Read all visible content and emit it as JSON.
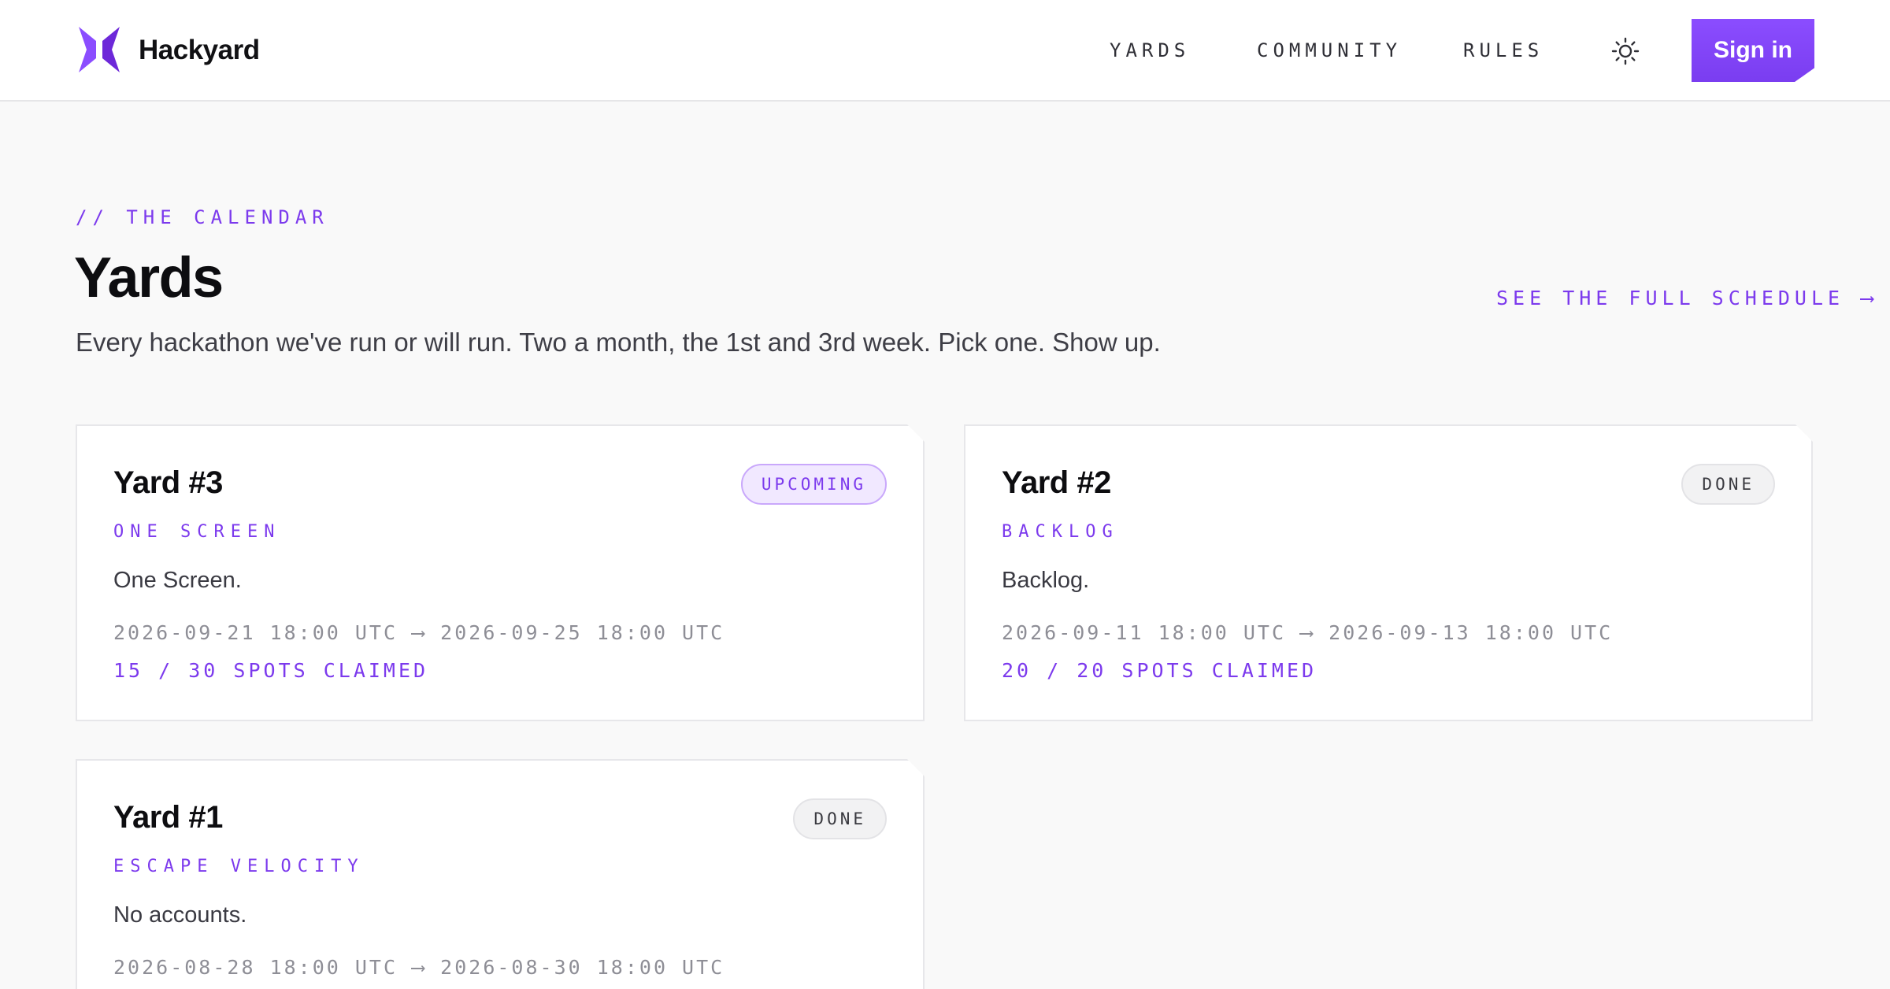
{
  "brand": {
    "name": "Hackyard",
    "accent": "#7c3aed"
  },
  "nav": {
    "items": [
      {
        "label": "YARDS"
      },
      {
        "label": "COMMUNITY"
      },
      {
        "label": "RULES"
      }
    ],
    "theme_icon": "sun-icon",
    "signin_label": "Sign in"
  },
  "hero": {
    "eyebrow": "// THE CALENDAR",
    "title": "Yards",
    "subtitle": "Every hackathon we've run or will run. Two a month, the 1st and 3rd week. Pick one. Show up.",
    "schedule_link": "SEE THE FULL SCHEDULE ⟶"
  },
  "yards": [
    {
      "title": "Yard #3",
      "status": "UPCOMING",
      "theme": "ONE SCREEN",
      "description": "One Screen.",
      "dates": "2026-09-21 18:00 UTC ⟶ 2026-09-25 18:00 UTC",
      "spots": "15 / 30 SPOTS CLAIMED"
    },
    {
      "title": "Yard #2",
      "status": "DONE",
      "theme": "BACKLOG",
      "description": "Backlog.",
      "dates": "2026-09-11 18:00 UTC ⟶ 2026-09-13 18:00 UTC",
      "spots": "20 / 20 SPOTS CLAIMED"
    },
    {
      "title": "Yard #1",
      "status": "DONE",
      "theme": "ESCAPE VELOCITY",
      "description": "No accounts.",
      "dates": "2026-08-28 18:00 UTC ⟶ 2026-08-30 18:00 UTC"
    }
  ]
}
